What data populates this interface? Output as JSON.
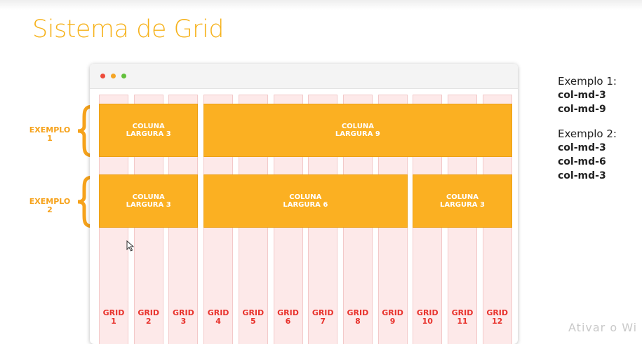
{
  "title": "Sistema de Grid",
  "browser": {
    "dots": [
      "red",
      "yellow",
      "green"
    ]
  },
  "grid_columns": [
    {
      "word": "GRID",
      "num": "1"
    },
    {
      "word": "GRID",
      "num": "2"
    },
    {
      "word": "GRID",
      "num": "3"
    },
    {
      "word": "GRID",
      "num": "4"
    },
    {
      "word": "GRID",
      "num": "5"
    },
    {
      "word": "GRID",
      "num": "6"
    },
    {
      "word": "GRID",
      "num": "7"
    },
    {
      "word": "GRID",
      "num": "8"
    },
    {
      "word": "GRID",
      "num": "9"
    },
    {
      "word": "GRID",
      "num": "10"
    },
    {
      "word": "GRID",
      "num": "11"
    },
    {
      "word": "GRID",
      "num": "12"
    }
  ],
  "examples": [
    {
      "label": "EXEMPLO",
      "number": "1",
      "blocks": [
        {
          "line1": "COLUNA",
          "line2": "LARGURA 3",
          "span": 3
        },
        {
          "line1": "COLUNA",
          "line2": "LARGURA 9",
          "span": 9
        }
      ]
    },
    {
      "label": "EXEMPLO",
      "number": "2",
      "blocks": [
        {
          "line1": "COLUNA",
          "line2": "LARGURA 3",
          "span": 3
        },
        {
          "line1": "COLUNA",
          "line2": "LARGURA 6",
          "span": 6
        },
        {
          "line1": "COLUNA",
          "line2": "LARGURA 3",
          "span": 3
        }
      ]
    }
  ],
  "sidebar": {
    "example1": {
      "heading": "Exemplo 1:",
      "classes": [
        "col-md-3",
        "col-md-9"
      ]
    },
    "example2": {
      "heading": "Exemplo 2:",
      "classes": [
        "col-md-3",
        "col-md-6",
        "col-md-3"
      ]
    }
  },
  "watermark": "Ativar o Wi",
  "colors": {
    "accent": "#f6b21b",
    "block": "#fbb022",
    "grid_bg": "#fde9e9",
    "grid_label": "#e8322c"
  }
}
